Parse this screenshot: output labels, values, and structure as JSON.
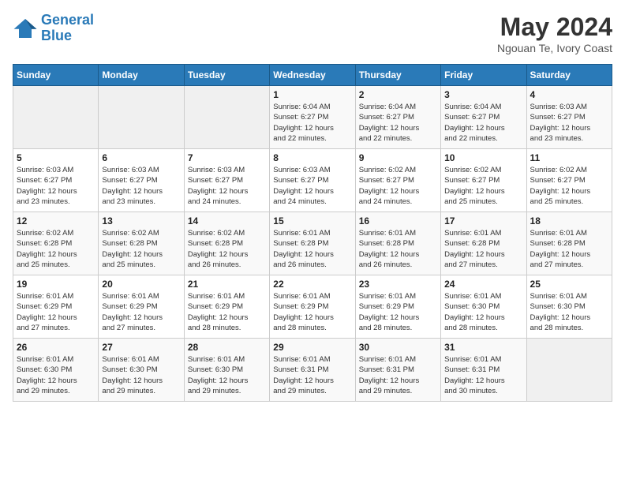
{
  "header": {
    "logo_line1": "General",
    "logo_line2": "Blue",
    "month_year": "May 2024",
    "location": "Ngouan Te, Ivory Coast"
  },
  "weekdays": [
    "Sunday",
    "Monday",
    "Tuesday",
    "Wednesday",
    "Thursday",
    "Friday",
    "Saturday"
  ],
  "weeks": [
    [
      {
        "day": "",
        "info": ""
      },
      {
        "day": "",
        "info": ""
      },
      {
        "day": "",
        "info": ""
      },
      {
        "day": "1",
        "info": "Sunrise: 6:04 AM\nSunset: 6:27 PM\nDaylight: 12 hours\nand 22 minutes."
      },
      {
        "day": "2",
        "info": "Sunrise: 6:04 AM\nSunset: 6:27 PM\nDaylight: 12 hours\nand 22 minutes."
      },
      {
        "day": "3",
        "info": "Sunrise: 6:04 AM\nSunset: 6:27 PM\nDaylight: 12 hours\nand 22 minutes."
      },
      {
        "day": "4",
        "info": "Sunrise: 6:03 AM\nSunset: 6:27 PM\nDaylight: 12 hours\nand 23 minutes."
      }
    ],
    [
      {
        "day": "5",
        "info": "Sunrise: 6:03 AM\nSunset: 6:27 PM\nDaylight: 12 hours\nand 23 minutes."
      },
      {
        "day": "6",
        "info": "Sunrise: 6:03 AM\nSunset: 6:27 PM\nDaylight: 12 hours\nand 23 minutes."
      },
      {
        "day": "7",
        "info": "Sunrise: 6:03 AM\nSunset: 6:27 PM\nDaylight: 12 hours\nand 24 minutes."
      },
      {
        "day": "8",
        "info": "Sunrise: 6:03 AM\nSunset: 6:27 PM\nDaylight: 12 hours\nand 24 minutes."
      },
      {
        "day": "9",
        "info": "Sunrise: 6:02 AM\nSunset: 6:27 PM\nDaylight: 12 hours\nand 24 minutes."
      },
      {
        "day": "10",
        "info": "Sunrise: 6:02 AM\nSunset: 6:27 PM\nDaylight: 12 hours\nand 25 minutes."
      },
      {
        "day": "11",
        "info": "Sunrise: 6:02 AM\nSunset: 6:27 PM\nDaylight: 12 hours\nand 25 minutes."
      }
    ],
    [
      {
        "day": "12",
        "info": "Sunrise: 6:02 AM\nSunset: 6:28 PM\nDaylight: 12 hours\nand 25 minutes."
      },
      {
        "day": "13",
        "info": "Sunrise: 6:02 AM\nSunset: 6:28 PM\nDaylight: 12 hours\nand 25 minutes."
      },
      {
        "day": "14",
        "info": "Sunrise: 6:02 AM\nSunset: 6:28 PM\nDaylight: 12 hours\nand 26 minutes."
      },
      {
        "day": "15",
        "info": "Sunrise: 6:01 AM\nSunset: 6:28 PM\nDaylight: 12 hours\nand 26 minutes."
      },
      {
        "day": "16",
        "info": "Sunrise: 6:01 AM\nSunset: 6:28 PM\nDaylight: 12 hours\nand 26 minutes."
      },
      {
        "day": "17",
        "info": "Sunrise: 6:01 AM\nSunset: 6:28 PM\nDaylight: 12 hours\nand 27 minutes."
      },
      {
        "day": "18",
        "info": "Sunrise: 6:01 AM\nSunset: 6:28 PM\nDaylight: 12 hours\nand 27 minutes."
      }
    ],
    [
      {
        "day": "19",
        "info": "Sunrise: 6:01 AM\nSunset: 6:29 PM\nDaylight: 12 hours\nand 27 minutes."
      },
      {
        "day": "20",
        "info": "Sunrise: 6:01 AM\nSunset: 6:29 PM\nDaylight: 12 hours\nand 27 minutes."
      },
      {
        "day": "21",
        "info": "Sunrise: 6:01 AM\nSunset: 6:29 PM\nDaylight: 12 hours\nand 28 minutes."
      },
      {
        "day": "22",
        "info": "Sunrise: 6:01 AM\nSunset: 6:29 PM\nDaylight: 12 hours\nand 28 minutes."
      },
      {
        "day": "23",
        "info": "Sunrise: 6:01 AM\nSunset: 6:29 PM\nDaylight: 12 hours\nand 28 minutes."
      },
      {
        "day": "24",
        "info": "Sunrise: 6:01 AM\nSunset: 6:30 PM\nDaylight: 12 hours\nand 28 minutes."
      },
      {
        "day": "25",
        "info": "Sunrise: 6:01 AM\nSunset: 6:30 PM\nDaylight: 12 hours\nand 28 minutes."
      }
    ],
    [
      {
        "day": "26",
        "info": "Sunrise: 6:01 AM\nSunset: 6:30 PM\nDaylight: 12 hours\nand 29 minutes."
      },
      {
        "day": "27",
        "info": "Sunrise: 6:01 AM\nSunset: 6:30 PM\nDaylight: 12 hours\nand 29 minutes."
      },
      {
        "day": "28",
        "info": "Sunrise: 6:01 AM\nSunset: 6:30 PM\nDaylight: 12 hours\nand 29 minutes."
      },
      {
        "day": "29",
        "info": "Sunrise: 6:01 AM\nSunset: 6:31 PM\nDaylight: 12 hours\nand 29 minutes."
      },
      {
        "day": "30",
        "info": "Sunrise: 6:01 AM\nSunset: 6:31 PM\nDaylight: 12 hours\nand 29 minutes."
      },
      {
        "day": "31",
        "info": "Sunrise: 6:01 AM\nSunset: 6:31 PM\nDaylight: 12 hours\nand 30 minutes."
      },
      {
        "day": "",
        "info": ""
      }
    ]
  ]
}
